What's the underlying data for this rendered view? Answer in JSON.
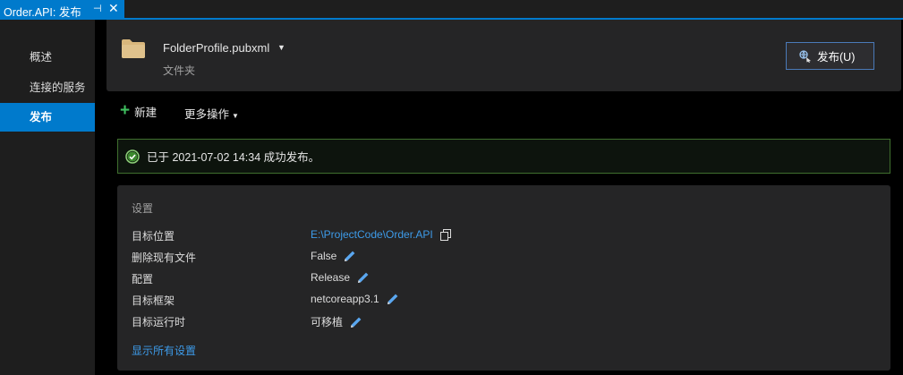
{
  "tab": {
    "title": "Order.API: 发布"
  },
  "sidebar": {
    "items": [
      {
        "label": "概述"
      },
      {
        "label": "连接的服务"
      },
      {
        "label": "发布"
      }
    ]
  },
  "header": {
    "profile_name": "FolderProfile.pubxml",
    "profile_type": "文件夹",
    "publish_button": "发布(U)"
  },
  "actions": {
    "new_label": "新建",
    "more_label": "更多操作"
  },
  "banner": {
    "message": "已于 2021-07-02 14:34 成功发布。"
  },
  "settings": {
    "title": "设置",
    "rows": [
      {
        "label": "目标位置",
        "value": "E:\\ProjectCode\\Order.API"
      },
      {
        "label": "删除现有文件",
        "value": "False"
      },
      {
        "label": "配置",
        "value": "Release"
      },
      {
        "label": "目标框架",
        "value": "netcoreapp3.1"
      },
      {
        "label": "目标运行时",
        "value": "可移植"
      }
    ],
    "show_all": "显示所有设置"
  },
  "colors": {
    "accent": "#007acc",
    "link": "#3d9be9",
    "success": "#3fbf5f"
  },
  "icons": [
    "pin-icon",
    "close-icon",
    "folder-icon",
    "chevron-down-icon",
    "publish-icon",
    "plus-icon",
    "check-circle-icon",
    "copy-icon",
    "pencil-icon"
  ]
}
